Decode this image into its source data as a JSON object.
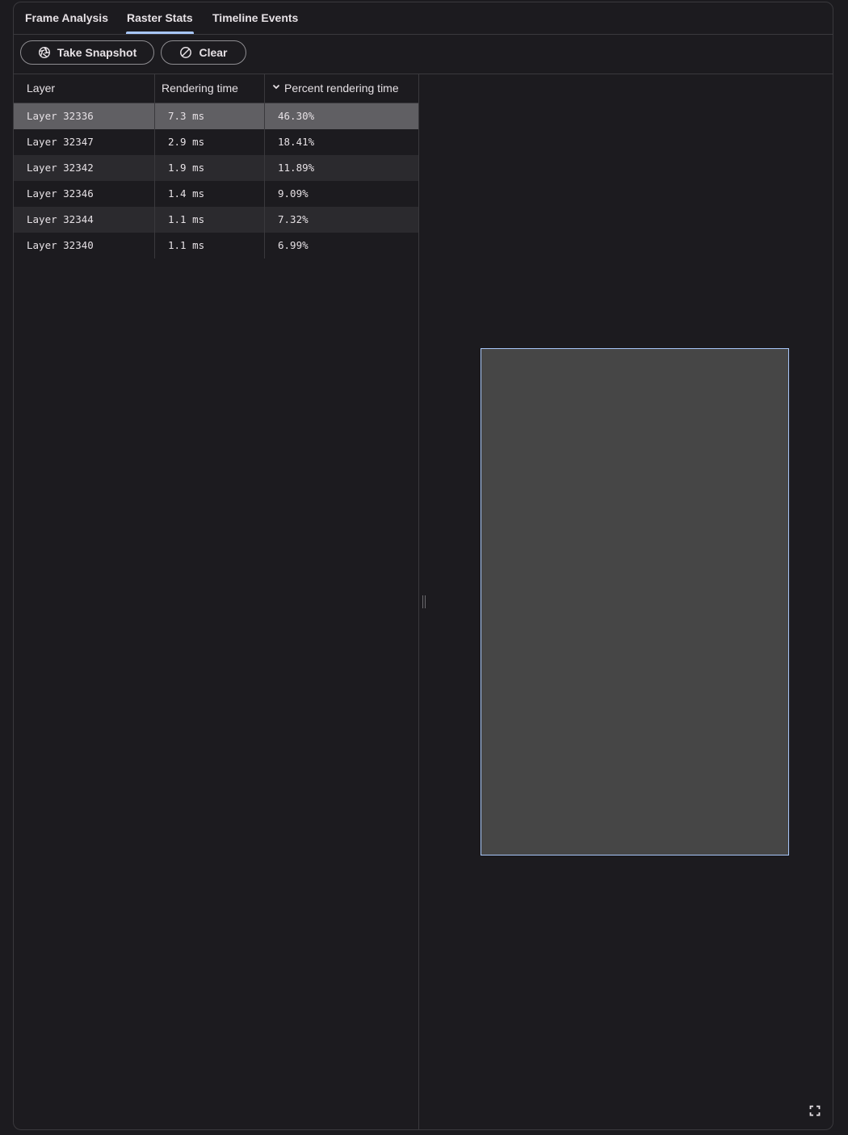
{
  "tabs": [
    {
      "label": "Frame Analysis",
      "active": false
    },
    {
      "label": "Raster Stats",
      "active": true
    },
    {
      "label": "Timeline Events",
      "active": false
    }
  ],
  "toolbar": {
    "snapshot_label": "Take Snapshot",
    "clear_label": "Clear"
  },
  "table": {
    "headers": [
      "Layer",
      "Rendering time",
      "Percent rendering time"
    ],
    "sort": {
      "column": "Percent rendering time",
      "direction": "descending"
    },
    "rows": [
      {
        "layer": "Layer 32336",
        "time": "7.3 ms",
        "percent": "46.30%",
        "selected": true
      },
      {
        "layer": "Layer 32347",
        "time": "2.9 ms",
        "percent": "18.41%"
      },
      {
        "layer": "Layer 32342",
        "time": "1.9 ms",
        "percent": "11.89%"
      },
      {
        "layer": "Layer 32346",
        "time": "1.4 ms",
        "percent": "9.09%"
      },
      {
        "layer": "Layer 32344",
        "time": "1.1 ms",
        "percent": "7.32%"
      },
      {
        "layer": "Layer 32340",
        "time": "1.1 ms",
        "percent": "6.99%"
      }
    ]
  },
  "icons": {
    "snapshot": "camera-shutter-icon",
    "clear": "block-icon",
    "sort": "chevron-down-icon",
    "fullscreen": "fullscreen-icon"
  },
  "colors": {
    "accent": "#a8c7fa",
    "selected_row": "#605f63",
    "preview_fill": "#464646"
  }
}
